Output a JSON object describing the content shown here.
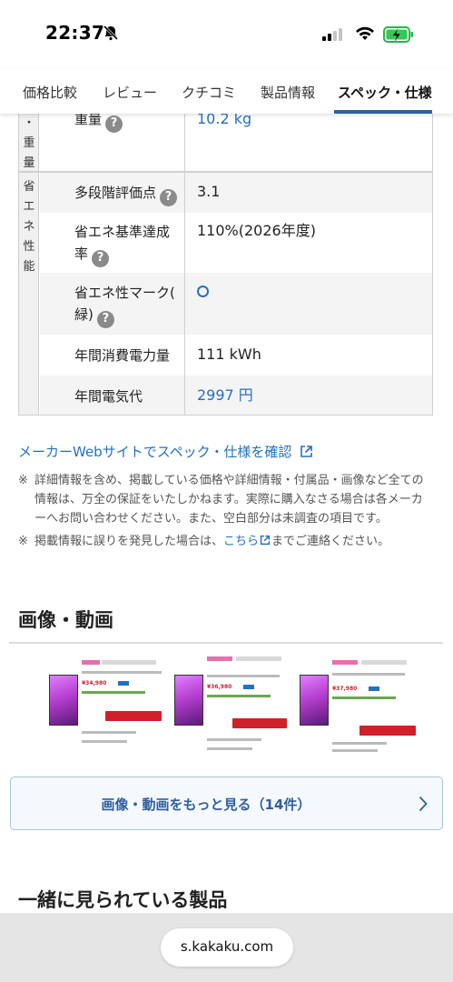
{
  "status_bar": {
    "time": "22:37"
  },
  "tabs": [
    {
      "label": "価格比較"
    },
    {
      "label": "レビュー"
    },
    {
      "label": "クチコミ"
    },
    {
      "label": "製品情報"
    },
    {
      "label": "スペック・仕様",
      "active": true
    }
  ],
  "spec": {
    "category_weight": "・重量",
    "category_eco": "省エネ性能",
    "rows": [
      {
        "label": "重量",
        "value": "10.2 kg"
      },
      {
        "label": "多段階評価点",
        "value": "3.1"
      },
      {
        "label": "省エネ基準達成",
        "label2": "率",
        "value": "110%(2026年度)"
      },
      {
        "label": "省エネ性マーク(",
        "label2": "緑)",
        "value": ""
      },
      {
        "label": "年間消費電力量",
        "value": "111 kWh"
      },
      {
        "label": "年間電気代",
        "value": "2997 円"
      }
    ]
  },
  "maker_link": "メーカーWebサイトでスペック・仕様を確認",
  "notes": {
    "mark": "※",
    "note1_l1": "詳細情報を含め、掲載している価格や詳細情報・付属品・画像など全ての",
    "note1_l2": "情報は、万全の保証をいたしかねます。実際に購入なさる場合は各メーカ",
    "note1_l3": "ーへお問い合わせください。また、空白部分は未調査の項目です。",
    "note2_a": "掲載情報に誤りを発見した場合は、",
    "note2_link": "こちら",
    "note2_b": "までご連絡ください。"
  },
  "images_section": {
    "title": "画像・動画",
    "more_button": "画像・動画をもっと見る（14件）",
    "thumbs": [
      {
        "price": "¥34,980",
        "title": "TCL P636 43P636 [43V型4Kチュ",
        "cart": "カートに入れる"
      },
      {
        "price": "¥36,980",
        "title": "TCL P636 43P636 [43V型4Kチュ",
        "cart": "カートに入れる"
      },
      {
        "price": "¥37,980",
        "title": "TCL P636 43P636 [43V型デジ",
        "cart": "カートに入れ"
      }
    ]
  },
  "related_section": {
    "title": "一緒に見られている製品"
  },
  "browser": {
    "url": "s.kakaku.com"
  },
  "colors": {
    "accent": "#2470c2",
    "tab_underline": "#2e5f9e"
  }
}
